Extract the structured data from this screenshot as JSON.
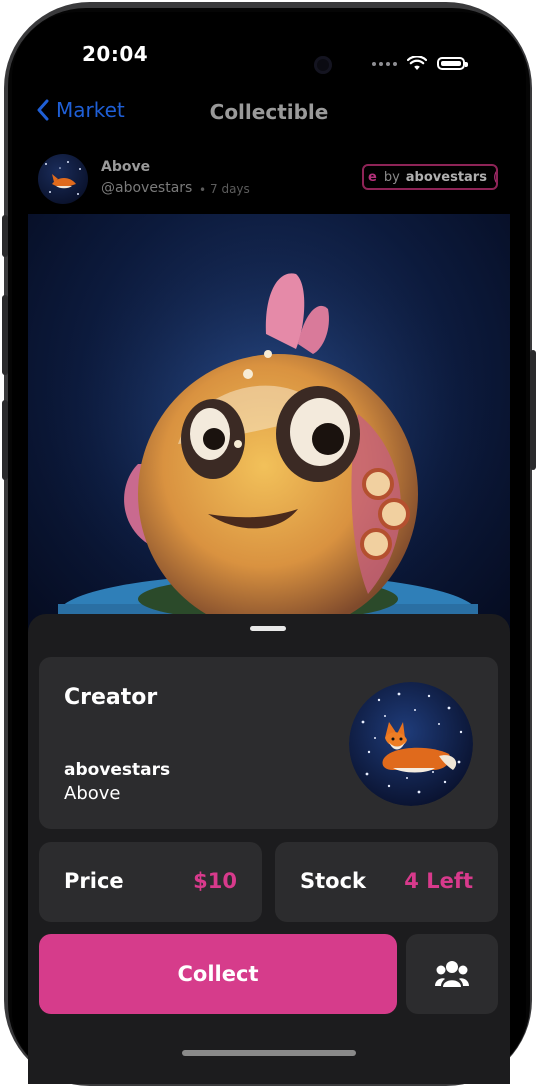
{
  "status_bar": {
    "time": "20:04"
  },
  "nav": {
    "back_label": "Market",
    "title": "Collectible"
  },
  "post": {
    "author_name": "Above",
    "author_handle": "@abovestars",
    "separator": "•",
    "time_ago": "7 days",
    "tag": {
      "prefix": "e",
      "by": "by",
      "name": "abovestars",
      "suffix": "("
    }
  },
  "creator": {
    "title": "Creator",
    "handle": "abovestars",
    "name": "Above"
  },
  "price": {
    "label": "Price",
    "value": "$10"
  },
  "stock": {
    "label": "Stock",
    "value": "4 Left"
  },
  "actions": {
    "collect_label": "Collect"
  },
  "icons": {
    "back": "chevron-left-icon",
    "wifi": "wifi-icon",
    "battery": "battery-icon",
    "group": "group-icon"
  },
  "colors": {
    "accent": "#d63c8b",
    "link": "#1f5fd6",
    "card": "#2c2c2e",
    "sheet": "#1c1c1e"
  }
}
